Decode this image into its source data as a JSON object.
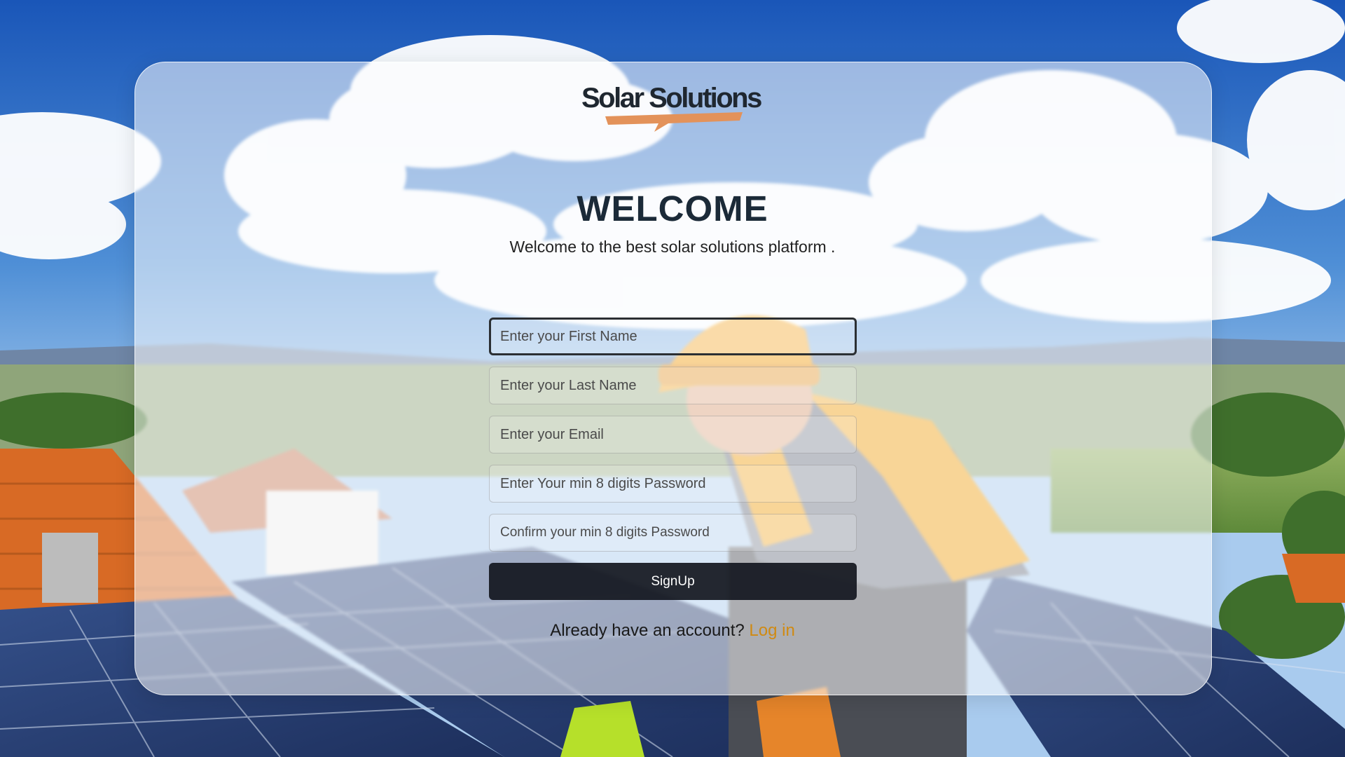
{
  "brand": {
    "name": "Solar Solutions",
    "accent_color": "#e08a3a",
    "text_color": "#1f2730"
  },
  "hero": {
    "title": "WELCOME",
    "subtitle": "Welcome to the best solar solutions platform ."
  },
  "form": {
    "first_name_placeholder": "Enter your First Name",
    "last_name_placeholder": "Enter your Last Name",
    "email_placeholder": "Enter your Email",
    "password_placeholder": "Enter Your min 8 digits Password",
    "confirm_password_placeholder": "Confirm your min 8 digits Password",
    "submit_label": "SignUp",
    "focused_field": "first_name"
  },
  "footer": {
    "prompt": "Already have an account?",
    "login_label": "Log in",
    "link_color": "#d08a12"
  }
}
